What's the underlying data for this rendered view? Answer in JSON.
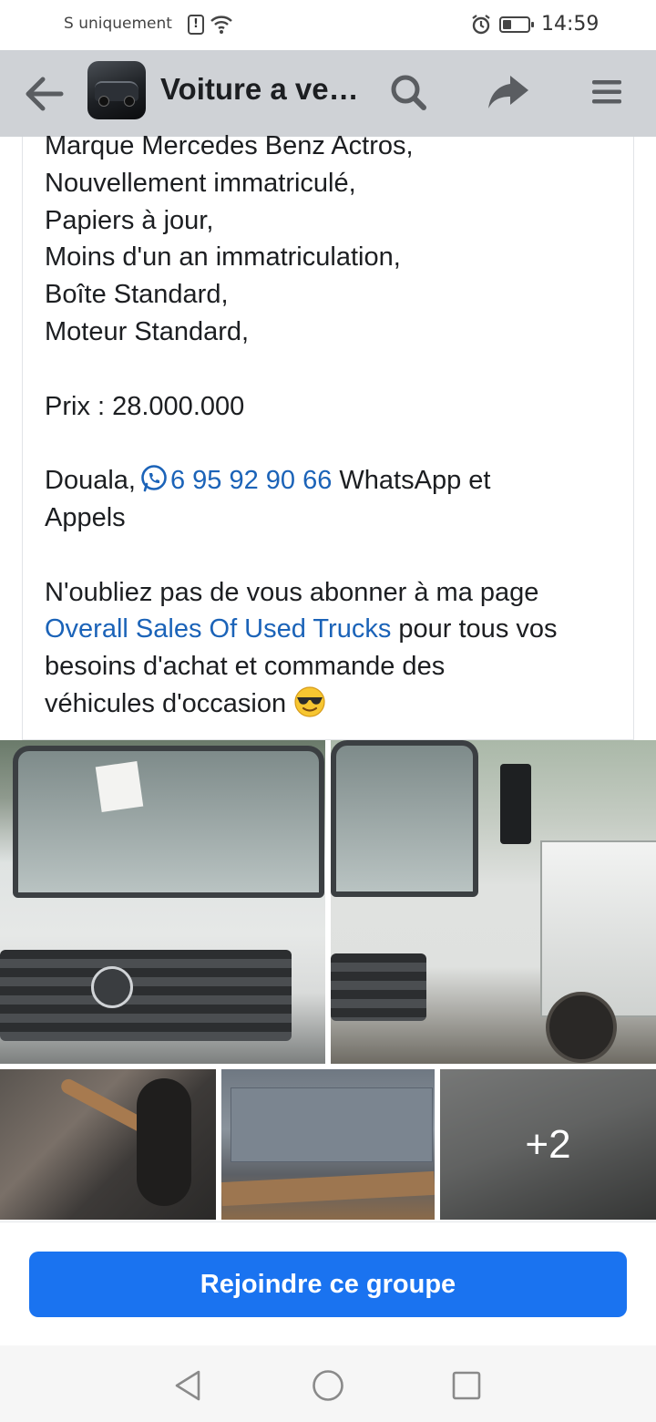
{
  "status_bar": {
    "left_text": "S uniquement",
    "time": "14:59"
  },
  "header": {
    "title": "Voiture a ve…",
    "icons": [
      "back-arrow-icon",
      "search-icon",
      "share-icon",
      "menu-icon"
    ]
  },
  "post": {
    "lines": [
      "Marque Mercedes Benz Actros,",
      "Nouvellement immatriculé,",
      "Papiers à jour,",
      "Moins d'un an immatriculation,",
      "Boîte Standard,",
      "Moteur Standard,"
    ],
    "price": "Prix : 28.000.000",
    "contact_prefix": "Douala,",
    "phone": "6 95 92 90 66",
    "contact_suffix": " WhatsApp et",
    "contact_suffix2": "Appels",
    "cta_line1": "N'oubliez pas de vous abonner à ma page",
    "page_link": "Overall Sales Of Used Trucks",
    "cta_line2_rest": " pour tous vos",
    "cta_line3": "besoins d'achat et commande des",
    "cta_line4": "véhicules d'occasion"
  },
  "photos": {
    "more_count": "+2"
  },
  "join": {
    "label": "Rejoindre ce groupe"
  },
  "colors": {
    "header_bg": "#cfd2d6",
    "link": "#1b63b8",
    "join_button": "#1a73f0"
  }
}
